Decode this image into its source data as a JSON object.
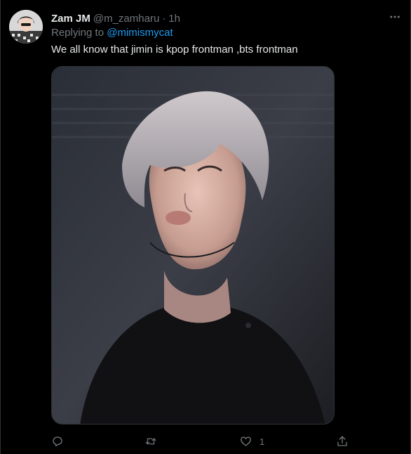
{
  "tweet": {
    "display_name": "Zam JM",
    "handle": "@m_zamharu",
    "separator": "·",
    "time": "1h",
    "replying_to_prefix": "Replying to ",
    "replying_to_handle": "@mimismycat",
    "text": "We all know that jimin is kpop frontman ,bts frontman"
  },
  "actions": {
    "reply_count": "",
    "retweet_count": "",
    "like_count": "1"
  },
  "icons": {
    "more": "more-horizontal-icon",
    "reply": "comment-icon",
    "retweet": "retweet-icon",
    "like": "heart-icon",
    "share": "share-icon"
  },
  "colors": {
    "background": "#000000",
    "text_primary": "#e7e9ea",
    "text_secondary": "#71767b",
    "accent": "#1d9bf0",
    "border": "#2f3336"
  }
}
